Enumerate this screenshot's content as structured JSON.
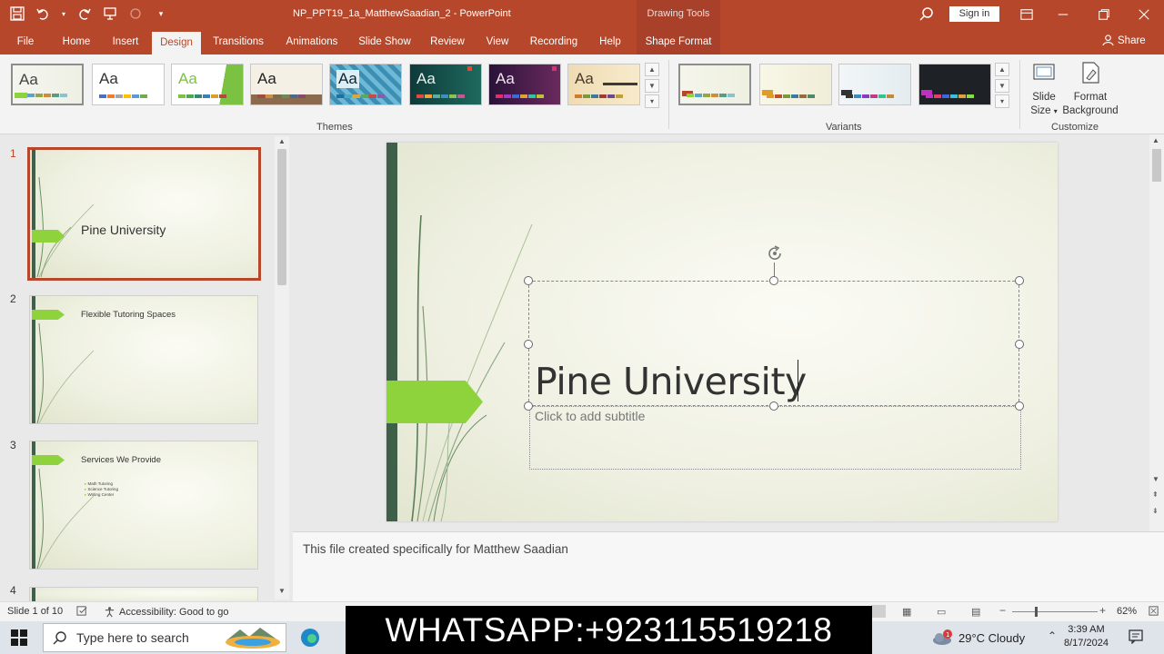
{
  "window": {
    "doc_title": "NP_PPT19_1a_MatthewSaadian_2  -  PowerPoint",
    "contextual_tab_group": "Drawing Tools",
    "sign_in": "Sign in"
  },
  "tabs": [
    {
      "label": "File"
    },
    {
      "label": "Home"
    },
    {
      "label": "Insert"
    },
    {
      "label": "Design"
    },
    {
      "label": "Transitions"
    },
    {
      "label": "Animations"
    },
    {
      "label": "Slide Show"
    },
    {
      "label": "Review"
    },
    {
      "label": "View"
    },
    {
      "label": "Recording"
    },
    {
      "label": "Help"
    },
    {
      "label": "Shape Format"
    }
  ],
  "share_label": "Share",
  "ribbon": {
    "themes_label": "Themes",
    "variants_label": "Variants",
    "customize_label": "Customize",
    "slide_size_label": "Slide",
    "slide_size_label2": "Size",
    "format_bg_label": "Format",
    "format_bg_label2": "Background",
    "theme_sample": "Aa"
  },
  "slides": [
    {
      "num": "1",
      "title": "Pine University"
    },
    {
      "num": "2",
      "title": "Flexible Tutoring Spaces"
    },
    {
      "num": "3",
      "title": "Services We Provide",
      "bullets": [
        "Math Tutoring",
        "Science Tutoring",
        "Writing Center"
      ]
    },
    {
      "num": "4"
    }
  ],
  "current_slide": {
    "title": "Pine University",
    "subtitle_placeholder": "Click to add subtitle"
  },
  "notes": "This file created specifically for Matthew Saadian",
  "status": {
    "slide_count": "Slide 1 of 10",
    "accessibility": "Accessibility: Good to go",
    "zoom": "62%"
  },
  "taskbar": {
    "search_placeholder": "Type here to search",
    "banner": "WHATSAPP:+923115519218",
    "weather": "29°C  Cloudy",
    "weather_badge": "1",
    "time": "3:39 AM",
    "date": "8/17/2024"
  },
  "colors": {
    "accent": "#b7472a",
    "slide_green": "#8fd33c",
    "slide_dark_bar": "#3f6048"
  }
}
